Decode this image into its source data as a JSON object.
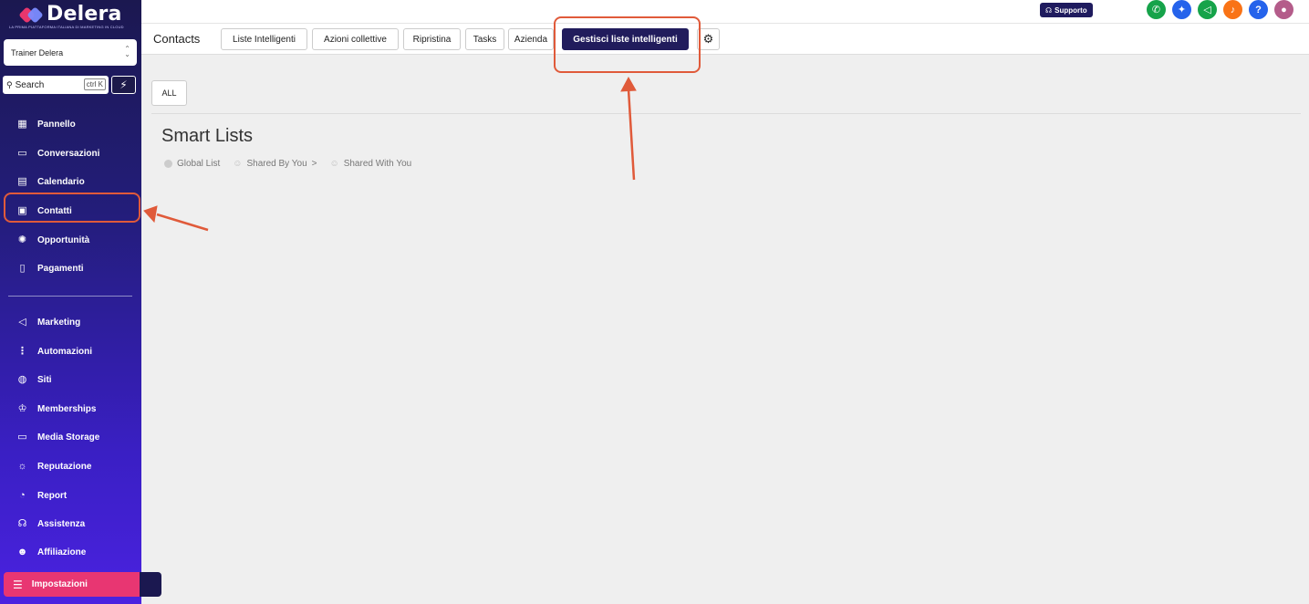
{
  "brand": {
    "name": "Delera",
    "tagline": "LA PRIMA PIATTAFORMA ITALIANA DI MARKETING IN CLOUD"
  },
  "account": {
    "name": "Trainer Delera"
  },
  "search": {
    "placeholder": "Search",
    "shortcut": "ctrl K"
  },
  "sidebar": {
    "items": [
      {
        "label": "Pannello",
        "icon": "grid-icon"
      },
      {
        "label": "Conversazioni",
        "icon": "chat-icon"
      },
      {
        "label": "Calendario",
        "icon": "calendar-icon"
      },
      {
        "label": "Contatti",
        "icon": "contact-icon"
      },
      {
        "label": "Opportunità",
        "icon": "filter-icon"
      },
      {
        "label": "Pagamenti",
        "icon": "receipt-icon"
      },
      {
        "label": "Marketing",
        "icon": "megaphone-icon"
      },
      {
        "label": "Automazioni",
        "icon": "flow-icon"
      },
      {
        "label": "Siti",
        "icon": "globe-icon"
      },
      {
        "label": "Memberships",
        "icon": "crown-icon"
      },
      {
        "label": "Media Storage",
        "icon": "storage-icon"
      },
      {
        "label": "Reputazione",
        "icon": "star-icon"
      },
      {
        "label": "Report",
        "icon": "chart-icon"
      },
      {
        "label": "Assistenza",
        "icon": "headset-icon"
      },
      {
        "label": "Affiliazione",
        "icon": "user-plus-icon"
      }
    ],
    "settings_label": "Impostazioni"
  },
  "topbar": {
    "support_label": "Supporto"
  },
  "tabbar": {
    "title": "Contacts",
    "tabs": [
      {
        "label": "Liste Intelligenti"
      },
      {
        "label": "Azioni collettive"
      },
      {
        "label": "Ripristina"
      },
      {
        "label": "Tasks"
      },
      {
        "label": "Azienda"
      },
      {
        "label": "Gestisci liste intelligenti"
      }
    ]
  },
  "main": {
    "all_label": "ALL",
    "title": "Smart Lists",
    "filters": [
      "Global List",
      "Shared By You",
      "Shared With You"
    ],
    "filter_separator": ">"
  },
  "colors": {
    "accent": "#211c5c",
    "brand_pink": "#e83672",
    "annotation": "#e05a3a"
  }
}
